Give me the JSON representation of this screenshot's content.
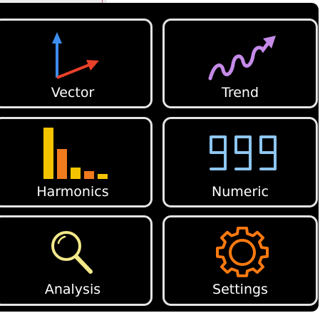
{
  "tiles": [
    {
      "label": "Vector",
      "icon": "vector-icon"
    },
    {
      "label": "Trend",
      "icon": "trend-icon"
    },
    {
      "label": "Harmonics",
      "icon": "harmonics-icon"
    },
    {
      "label": "Numeric",
      "icon": "numeric-icon",
      "display": "999"
    },
    {
      "label": "Analysis",
      "icon": "magnifier-icon"
    },
    {
      "label": "Settings",
      "icon": "gear-icon"
    }
  ],
  "colors": {
    "panel": "#000000",
    "tile_border": "#e4e4e4",
    "label": "#ffffff",
    "vector_blue": "#3d8ef0",
    "vector_red": "#e8402a",
    "trend": "#c48be8",
    "harmonics_yellow": "#f5c400",
    "harmonics_orange": "#f07a1e",
    "numeric": "#8ec6f2",
    "analysis": "#f2e88a",
    "settings": "#ff7a10"
  }
}
